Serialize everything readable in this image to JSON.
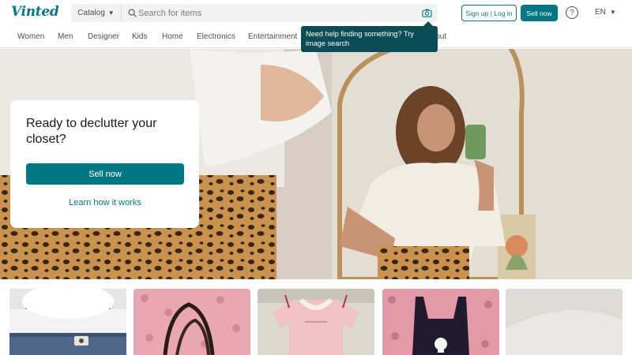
{
  "brand": {
    "logo_text": "Vinted",
    "accent": "#007782"
  },
  "search": {
    "category_label": "Catalog",
    "placeholder": "Search for items"
  },
  "header": {
    "signup_login_label": "Sign up | Log in",
    "sell_label": "Sell now",
    "help_icon": "question-circle-icon",
    "language": "EN"
  },
  "categories": [
    "Women",
    "Men",
    "Designer",
    "Kids",
    "Home",
    "Electronics",
    "Entertainment",
    "About"
  ],
  "tooltip": {
    "text": "Need help finding something? Try image search"
  },
  "hero": {
    "title": "Ready to declutter your closet?",
    "cta_label": "Sell now",
    "secondary_label": "Learn how it works"
  },
  "products": [
    {
      "name": "denim-shorts"
    },
    {
      "name": "black-bag-on-pink"
    },
    {
      "name": "pink-baby-tee"
    },
    {
      "name": "skull-tank-top"
    },
    {
      "name": "white-item"
    }
  ]
}
